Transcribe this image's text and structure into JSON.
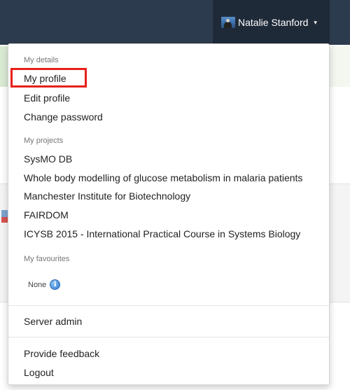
{
  "navbar": {
    "user_name": "Natalie Stanford",
    "caret": "▾"
  },
  "menu": {
    "my_details_header": "My details",
    "my_details_items": [
      "My profile",
      "Edit profile",
      "Change password"
    ],
    "my_projects_header": "My projects",
    "my_projects_items": [
      "SysMO DB",
      "Whole body modelling of glucose metabolism in malaria patients",
      "Manchester Institute for Biotechnology",
      "FAIRDOM",
      "ICYSB 2015 - International Practical Course in Systems Biology"
    ],
    "my_favourites_header": "My favourites",
    "favourites_none": "None",
    "info_glyph": "i",
    "server_admin": "Server admin",
    "provide_feedback": "Provide feedback",
    "logout": "Logout"
  },
  "colors": {
    "navbar": "#2d3b4e",
    "highlight_box": "#e6201a",
    "info_icon": "#2f7ad0"
  }
}
